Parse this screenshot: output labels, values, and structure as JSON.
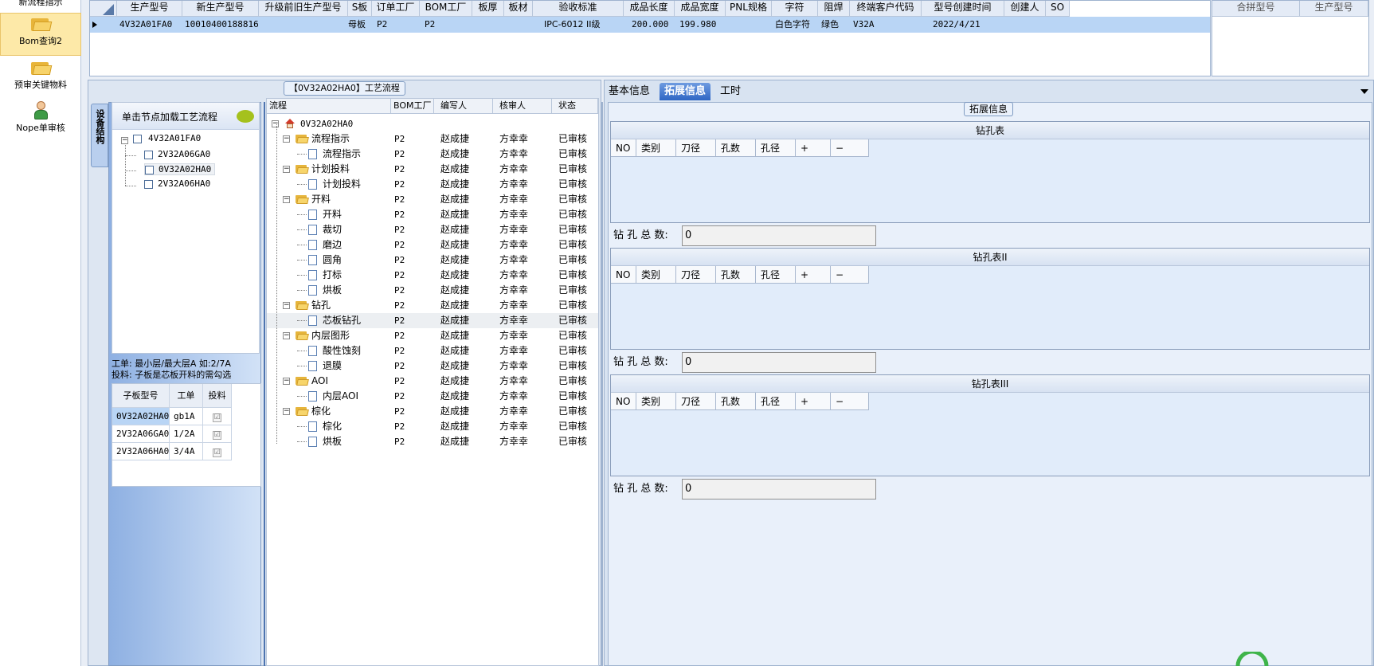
{
  "nav": {
    "top_cut_label": "新流程指示",
    "items": [
      {
        "label": "Bom查询2",
        "icon": "folder-icon",
        "selected": true
      },
      {
        "label": "预审关键物料",
        "icon": "folder-icon",
        "selected": false
      },
      {
        "label": "Nope单审核",
        "icon": "user-icon",
        "selected": false
      }
    ]
  },
  "top_grid": {
    "headers": [
      "生产型号",
      "新生产型号",
      "升级前旧生产型号",
      "S板",
      "订单工厂",
      "BOM工厂",
      "板厚",
      "板材",
      "验收标准",
      "成品长度",
      "成品宽度",
      "PNL规格",
      "字符",
      "阻焊",
      "终端客户代码",
      "型号创建时间",
      "创建人",
      "SO"
    ],
    "row": [
      "4V32A01FA0",
      "10010400188816",
      "",
      "母板",
      "P2",
      "P2",
      "",
      "",
      "IPC-6012 II级",
      "200.000",
      "199.980",
      "",
      "白色字符",
      "绿色",
      "V32A",
      "2022/4/21",
      "",
      ""
    ]
  },
  "right_grid": {
    "headers": [
      "合拼型号",
      "生产型号"
    ]
  },
  "center": {
    "process_group_title": "【0V32A02HA0】工艺流程",
    "vertical_tab": "设备结构",
    "tree_header": "单击节点加载工艺流程",
    "tree": {
      "root": "4V32A01FA0",
      "children": [
        "2V32A06GA0",
        "0V32A02HA0",
        "2V32A06HA0"
      ]
    },
    "notes": [
      "工单: 最小层/最大层A 如:2/7A",
      "投料: 子板是芯板开料的需勾选"
    ],
    "sub_table": {
      "headers": [
        "子板型号",
        "工单",
        "投料"
      ],
      "rows": [
        {
          "model": "0V32A02HA0",
          "order": "gb1A",
          "feed": "☑",
          "selected": true
        },
        {
          "model": "2V32A06GA0",
          "order": "1/2A",
          "feed": "☑",
          "selected": false
        },
        {
          "model": "2V32A06HA0",
          "order": "3/4A",
          "feed": "☑",
          "selected": false
        }
      ]
    },
    "process": {
      "headers": [
        "流程",
        "BOM工厂",
        "编写人",
        "核审人",
        "状态"
      ],
      "root": "0V32A02HA0",
      "rows": [
        {
          "name": "流程指示",
          "level": 1,
          "factory": "P2",
          "writer": "赵成捷",
          "reviewer": "方幸幸",
          "status": "已审核"
        },
        {
          "name": "流程指示",
          "level": 2,
          "factory": "P2",
          "writer": "赵成捷",
          "reviewer": "方幸幸",
          "status": "已审核"
        },
        {
          "name": "计划投料",
          "level": 1,
          "factory": "P2",
          "writer": "赵成捷",
          "reviewer": "方幸幸",
          "status": "已审核"
        },
        {
          "name": "计划投料",
          "level": 2,
          "factory": "P2",
          "writer": "赵成捷",
          "reviewer": "方幸幸",
          "status": "已审核"
        },
        {
          "name": "开料",
          "level": 1,
          "factory": "P2",
          "writer": "赵成捷",
          "reviewer": "方幸幸",
          "status": "已审核"
        },
        {
          "name": "开料",
          "level": 2,
          "factory": "P2",
          "writer": "赵成捷",
          "reviewer": "方幸幸",
          "status": "已审核"
        },
        {
          "name": "裁切",
          "level": 2,
          "factory": "P2",
          "writer": "赵成捷",
          "reviewer": "方幸幸",
          "status": "已审核"
        },
        {
          "name": "磨边",
          "level": 2,
          "factory": "P2",
          "writer": "赵成捷",
          "reviewer": "方幸幸",
          "status": "已审核"
        },
        {
          "name": "圆角",
          "level": 2,
          "factory": "P2",
          "writer": "赵成捷",
          "reviewer": "方幸幸",
          "status": "已审核"
        },
        {
          "name": "打标",
          "level": 2,
          "factory": "P2",
          "writer": "赵成捷",
          "reviewer": "方幸幸",
          "status": "已审核"
        },
        {
          "name": "烘板",
          "level": 2,
          "factory": "P2",
          "writer": "赵成捷",
          "reviewer": "方幸幸",
          "status": "已审核"
        },
        {
          "name": "钻孔",
          "level": 1,
          "factory": "P2",
          "writer": "赵成捷",
          "reviewer": "方幸幸",
          "status": "已审核"
        },
        {
          "name": "芯板钻孔",
          "level": 2,
          "factory": "P2",
          "writer": "赵成捷",
          "reviewer": "方幸幸",
          "status": "已审核",
          "highlight": true
        },
        {
          "name": "内层图形",
          "level": 1,
          "factory": "P2",
          "writer": "赵成捷",
          "reviewer": "方幸幸",
          "status": "已审核"
        },
        {
          "name": "酸性蚀刻",
          "level": 2,
          "factory": "P2",
          "writer": "赵成捷",
          "reviewer": "方幸幸",
          "status": "已审核"
        },
        {
          "name": "退膜",
          "level": 2,
          "factory": "P2",
          "writer": "赵成捷",
          "reviewer": "方幸幸",
          "status": "已审核"
        },
        {
          "name": "AOI",
          "level": 1,
          "factory": "P2",
          "writer": "赵成捷",
          "reviewer": "方幸幸",
          "status": "已审核"
        },
        {
          "name": "内层AOI",
          "level": 2,
          "factory": "P2",
          "writer": "赵成捷",
          "reviewer": "方幸幸",
          "status": "已审核"
        },
        {
          "name": "棕化",
          "level": 1,
          "factory": "P2",
          "writer": "赵成捷",
          "reviewer": "方幸幸",
          "status": "已审核"
        },
        {
          "name": "棕化",
          "level": 2,
          "factory": "P2",
          "writer": "赵成捷",
          "reviewer": "方幸幸",
          "status": "已审核"
        },
        {
          "name": "烘板",
          "level": 2,
          "factory": "P2",
          "writer": "赵成捷",
          "reviewer": "方幸幸",
          "status": "已审核"
        }
      ]
    }
  },
  "right": {
    "tabs": [
      "基本信息",
      "拓展信息",
      "工时"
    ],
    "active_tab": "拓展信息",
    "group_title": "拓展信息",
    "drill_headers": [
      "NO",
      "类别",
      "刀径",
      "孔数",
      "孔径",
      "+",
      "−"
    ],
    "total_label": "钻 孔 总 数:",
    "sections": [
      {
        "title": "钻孔表",
        "total": "0"
      },
      {
        "title": "钻孔表II",
        "total": "0"
      },
      {
        "title": "钻孔表III",
        "total": "0"
      }
    ]
  },
  "colors": {
    "selected_row": "#b9d5f5",
    "tab_active": "#2f66c4",
    "nav_selected": "#fde9a8"
  }
}
